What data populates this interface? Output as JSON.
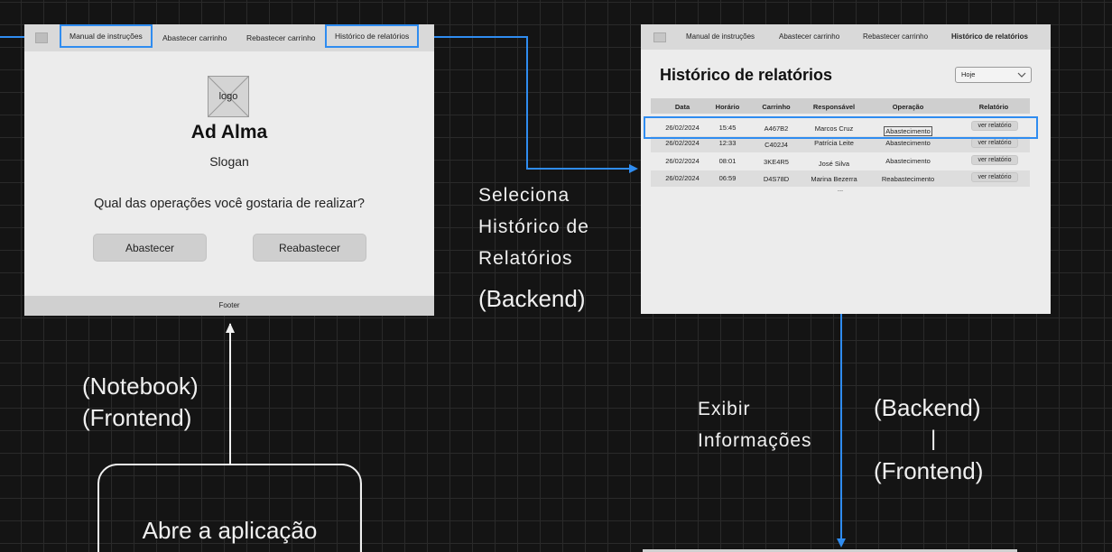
{
  "home": {
    "nav": [
      "Manual de instruções",
      "Abastecer carrinho",
      "Rebastecer carrinho",
      "Histórico de relatórios"
    ],
    "logo_text": "logo",
    "brand": "Ad Alma",
    "slogan": "Slogan",
    "question": "Qual das operações você gostaria de realizar?",
    "buttons": [
      "Abastecer",
      "Reabastecer"
    ],
    "footer": "Footer"
  },
  "reports": {
    "nav": [
      "Manual de instruções",
      "Abastecer carrinho",
      "Rebastecer carrinho",
      "Histórico de relatórios"
    ],
    "title": "Histórico de relatórios",
    "filter": "Hoje",
    "headers": [
      "Data",
      "Horário",
      "Carrinho",
      "Responsável",
      "Operação",
      "Relatório"
    ],
    "rows": [
      [
        "26/02/2024",
        "15:45",
        "A467B2",
        "Marcos Cruz",
        "Abastecimento",
        "ver relatório"
      ],
      [
        "26/02/2024",
        "12:33",
        "C402J4",
        "Patrícia Leite",
        "Abastecimento",
        "ver relatório"
      ],
      [
        "26/02/2024",
        "08:01",
        "3KE4R5",
        "José Silva",
        "Abastecimento",
        "ver relatório"
      ],
      [
        "26/02/2024",
        "06:59",
        "D4S78D",
        "Marina Bezerra",
        "Reabastecimento",
        "ver relatório"
      ]
    ],
    "more": "..."
  },
  "labels": {
    "select_report": [
      "Seleciona",
      "Histórico de",
      "Relatórios",
      "(Backend)"
    ],
    "device": [
      "(Notebook)",
      "(Frontend)"
    ],
    "show_info": [
      "Exibir",
      "Informações"
    ],
    "backend_frontend": [
      "(Backend)",
      "|",
      "(Frontend)"
    ],
    "start": "Abre a aplicação"
  },
  "colors": {
    "background": "#141414",
    "connector": "#2f8cf0",
    "label_text": "#f0f0f0"
  }
}
